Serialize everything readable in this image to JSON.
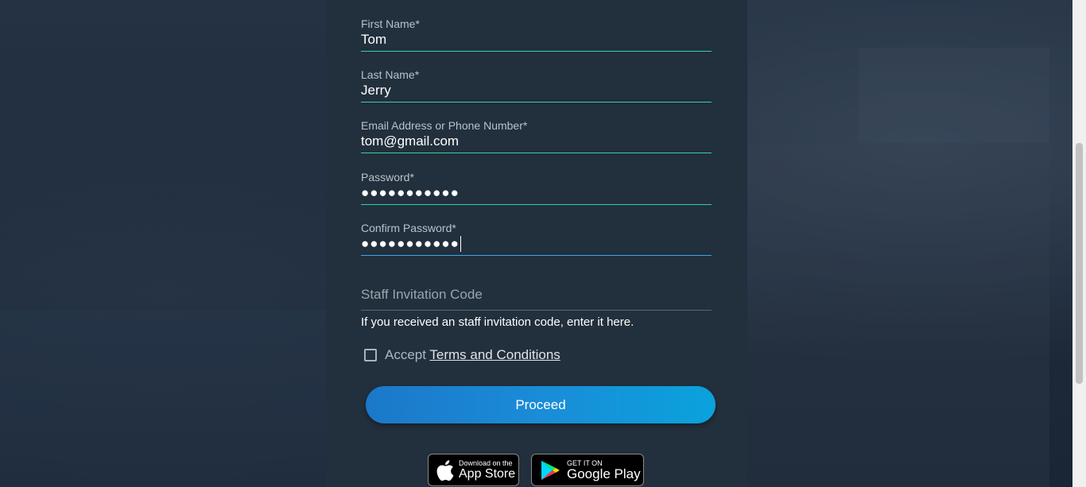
{
  "form": {
    "first_name": {
      "label": "First Name*",
      "value": "Tom"
    },
    "last_name": {
      "label": "Last Name*",
      "value": "Jerry"
    },
    "email": {
      "label": "Email Address or Phone Number*",
      "value": "tom@gmail.com"
    },
    "password": {
      "label": "Password*",
      "value": "●●●●●●●●●●●"
    },
    "confirm_password": {
      "label": "Confirm Password*",
      "value": "●●●●●●●●●●●"
    },
    "staff_code": {
      "placeholder": "Staff Invitation Code",
      "hint": "If you received an staff invitation code, enter it here."
    },
    "accept": {
      "prefix": "Accept ",
      "link": "Terms and Conditions",
      "checked": false
    },
    "proceed_label": "Proceed"
  },
  "stores": {
    "app_store": {
      "small": "Download on the",
      "big": "App Store",
      "icon": "apple-icon"
    },
    "google_play": {
      "small": "GET IT ON",
      "big": "Google Play",
      "icon": "google-play-icon"
    }
  },
  "colors": {
    "panel": "#222f3c",
    "underline_valid": "#2fd4a7",
    "underline_focused": "#36a8e8",
    "button_start": "#1b78c9",
    "button_end": "#0aa2dc"
  }
}
